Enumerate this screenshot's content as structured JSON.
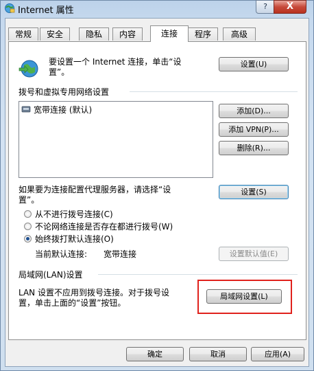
{
  "window": {
    "title": "Internet 属性",
    "help_label": "?",
    "close_label": "X"
  },
  "tabs": [
    {
      "label": "常规"
    },
    {
      "label": "安全"
    },
    {
      "label": "隐私"
    },
    {
      "label": "内容"
    },
    {
      "label": "连接"
    },
    {
      "label": "程序"
    },
    {
      "label": "高级"
    }
  ],
  "active_tab": "连接",
  "setup": {
    "text_line1": "要设置一个 Internet 连接，单击“设",
    "text_line2": "置”。",
    "button": "设置(U)"
  },
  "dialup": {
    "group_title": "拨号和虚拟专用网络设置",
    "connections": [
      "宽带连接 (默认)"
    ],
    "add_button": "添加(D)...",
    "add_vpn_button": "添加 VPN(P)...",
    "remove_button": "删除(R)...",
    "proxy_text_line1": "如果要为连接配置代理服务器，请选择“设",
    "proxy_text_line2": "置”。",
    "settings_button": "设置(S)"
  },
  "dial_options": [
    {
      "label": "从不进行拨号连接(C)",
      "checked": false
    },
    {
      "label": "不论网络连接是否存在都进行拨号(W)",
      "checked": false
    },
    {
      "label": "始终拨打默认连接(O)",
      "checked": true
    }
  ],
  "default_connection": {
    "label": "当前默认连接:",
    "value": "宽带连接",
    "button": "设置默认值(E)"
  },
  "lan": {
    "group_title": "局域网(LAN)设置",
    "text_line1": "LAN 设置不应用到拨号连接。对于拨号设",
    "text_line2": "置，单击上面的“设置”按钮。",
    "button": "局域网设置(L)"
  },
  "footer": {
    "ok": "确定",
    "cancel": "取消",
    "apply": "应用(A)"
  },
  "colors": {
    "highlight_box": "#e0211c"
  }
}
